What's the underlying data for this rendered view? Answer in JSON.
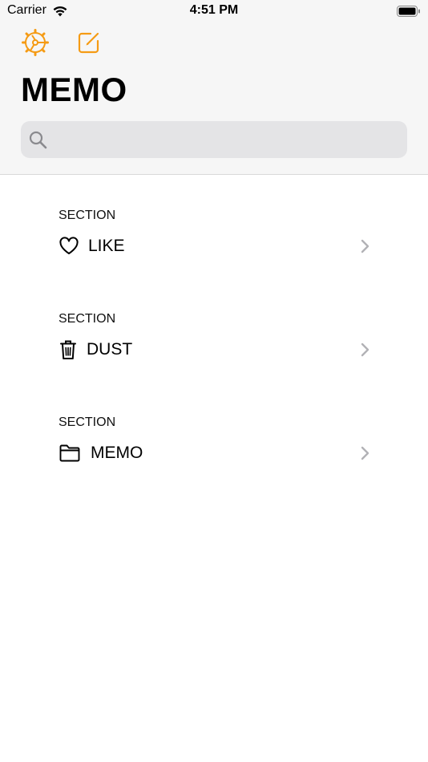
{
  "status_bar": {
    "carrier": "Carrier",
    "time": "4:51 PM"
  },
  "toolbar": {
    "settings_icon": "gear-icon",
    "compose_icon": "compose-icon",
    "accent_color": "#F59B14"
  },
  "header": {
    "title": "MEMO"
  },
  "search": {
    "placeholder": "",
    "value": ""
  },
  "sections": [
    {
      "header": "SECTION",
      "label": "LIKE",
      "icon": "heart-icon"
    },
    {
      "header": "SECTION",
      "label": "DUST",
      "icon": "trash-icon"
    },
    {
      "header": "SECTION",
      "label": "MEMO",
      "icon": "folder-icon"
    }
  ]
}
